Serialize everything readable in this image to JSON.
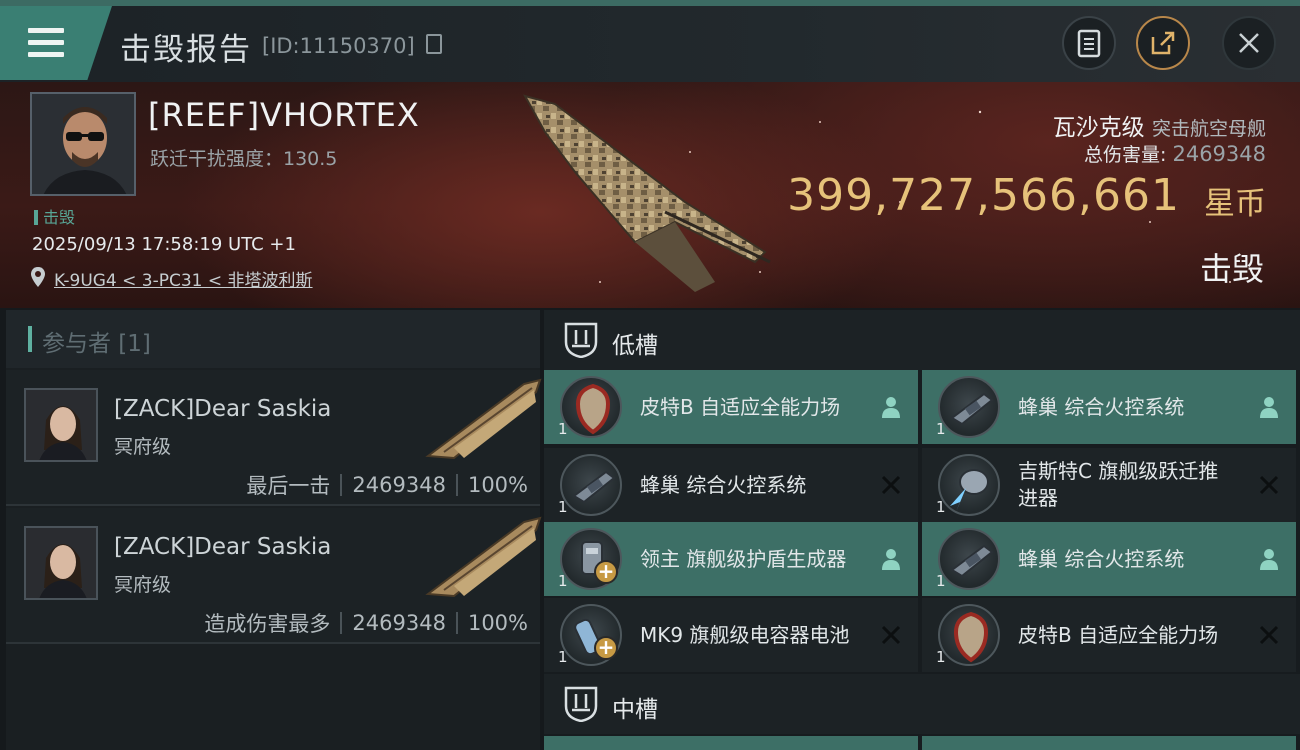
{
  "header": {
    "title": "击毁报告",
    "report_id": "[ID:11150370]"
  },
  "victim": {
    "name": "[REEF]VHORTEX",
    "warp_label": "跃迁干扰强度：130.5",
    "status": "击毁",
    "timestamp": "2025/09/13 17:58:19 UTC +1",
    "location": "K-9UG4 < 3-PC31 < 非塔波利斯",
    "ship_class": "瓦沙克级",
    "ship_type": "突击航空母舰",
    "total_damage_label": "总伤害量:",
    "total_damage_value": "2469348",
    "isk_value": "399,727,566,661",
    "isk_unit": "星币",
    "result": "击毁"
  },
  "participants": {
    "header": "参与者 [1]",
    "entries": [
      {
        "name": "[ZACK]Dear Saskia",
        "ship": "冥府级",
        "role": "最后一击",
        "damage": "2469348",
        "percent": "100%"
      },
      {
        "name": "[ZACK]Dear Saskia",
        "ship": "冥府级",
        "role": "造成伤害最多",
        "damage": "2469348",
        "percent": "100%"
      }
    ]
  },
  "fitting": {
    "low_slot_label": "低槽",
    "mid_slot_label": "中槽",
    "low_slots": [
      {
        "name": "皮特B 自适应全能力场",
        "qty": "1",
        "state": "dropped",
        "icon": "armor-plate-icon"
      },
      {
        "name": "蜂巢 综合火控系统",
        "qty": "1",
        "state": "dropped",
        "icon": "fire-control-icon"
      },
      {
        "name": "蜂巢 综合火控系统",
        "qty": "1",
        "state": "destroyed",
        "icon": "fire-control-icon"
      },
      {
        "name": "吉斯特C 旗舰级跃迁推进器",
        "qty": "1",
        "state": "destroyed",
        "icon": "warp-thruster-icon"
      },
      {
        "name": "领主 旗舰级护盾生成器",
        "qty": "1",
        "state": "dropped",
        "icon": "shield-generator-icon"
      },
      {
        "name": "蜂巢 综合火控系统",
        "qty": "1",
        "state": "dropped",
        "icon": "fire-control-icon"
      },
      {
        "name": "MK9 旗舰级电容器电池",
        "qty": "1",
        "state": "destroyed",
        "icon": "capacitor-battery-icon"
      },
      {
        "name": "皮特B 自适应全能力场",
        "qty": "1",
        "state": "destroyed",
        "icon": "armor-plate-icon"
      }
    ]
  },
  "colors": {
    "accent_teal": "#3d6f66",
    "isk_gold": "#e6c27a",
    "menu_tab": "#3a7f73"
  }
}
